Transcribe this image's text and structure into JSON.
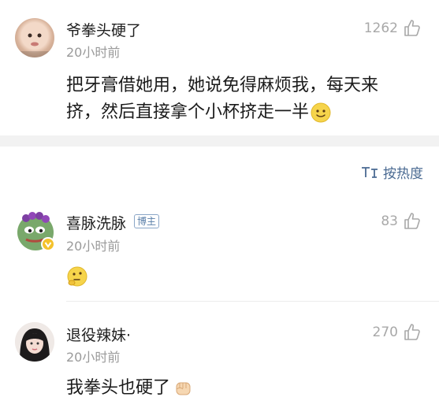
{
  "comments": [
    {
      "username": "爷拳头硬了",
      "time": "20小时前",
      "likes": "1262",
      "text_line1": "把牙膏借她用，她说免得麻烦我，每天来",
      "text_line2": "挤，然后直接拿个小杯挤走一半"
    },
    {
      "username": "喜脉洗脉",
      "badge": "博主",
      "time": "20小时前",
      "likes": "83"
    },
    {
      "username": "退役辣妹·",
      "time": "20小时前",
      "likes": "270",
      "text": "我拳头也硬了"
    }
  ],
  "sort": {
    "label": "按热度",
    "icon": "sort-icon"
  },
  "colors": {
    "link": "#4a6a92",
    "muted": "#9a9a9a",
    "separator": "#f2f2f2"
  }
}
